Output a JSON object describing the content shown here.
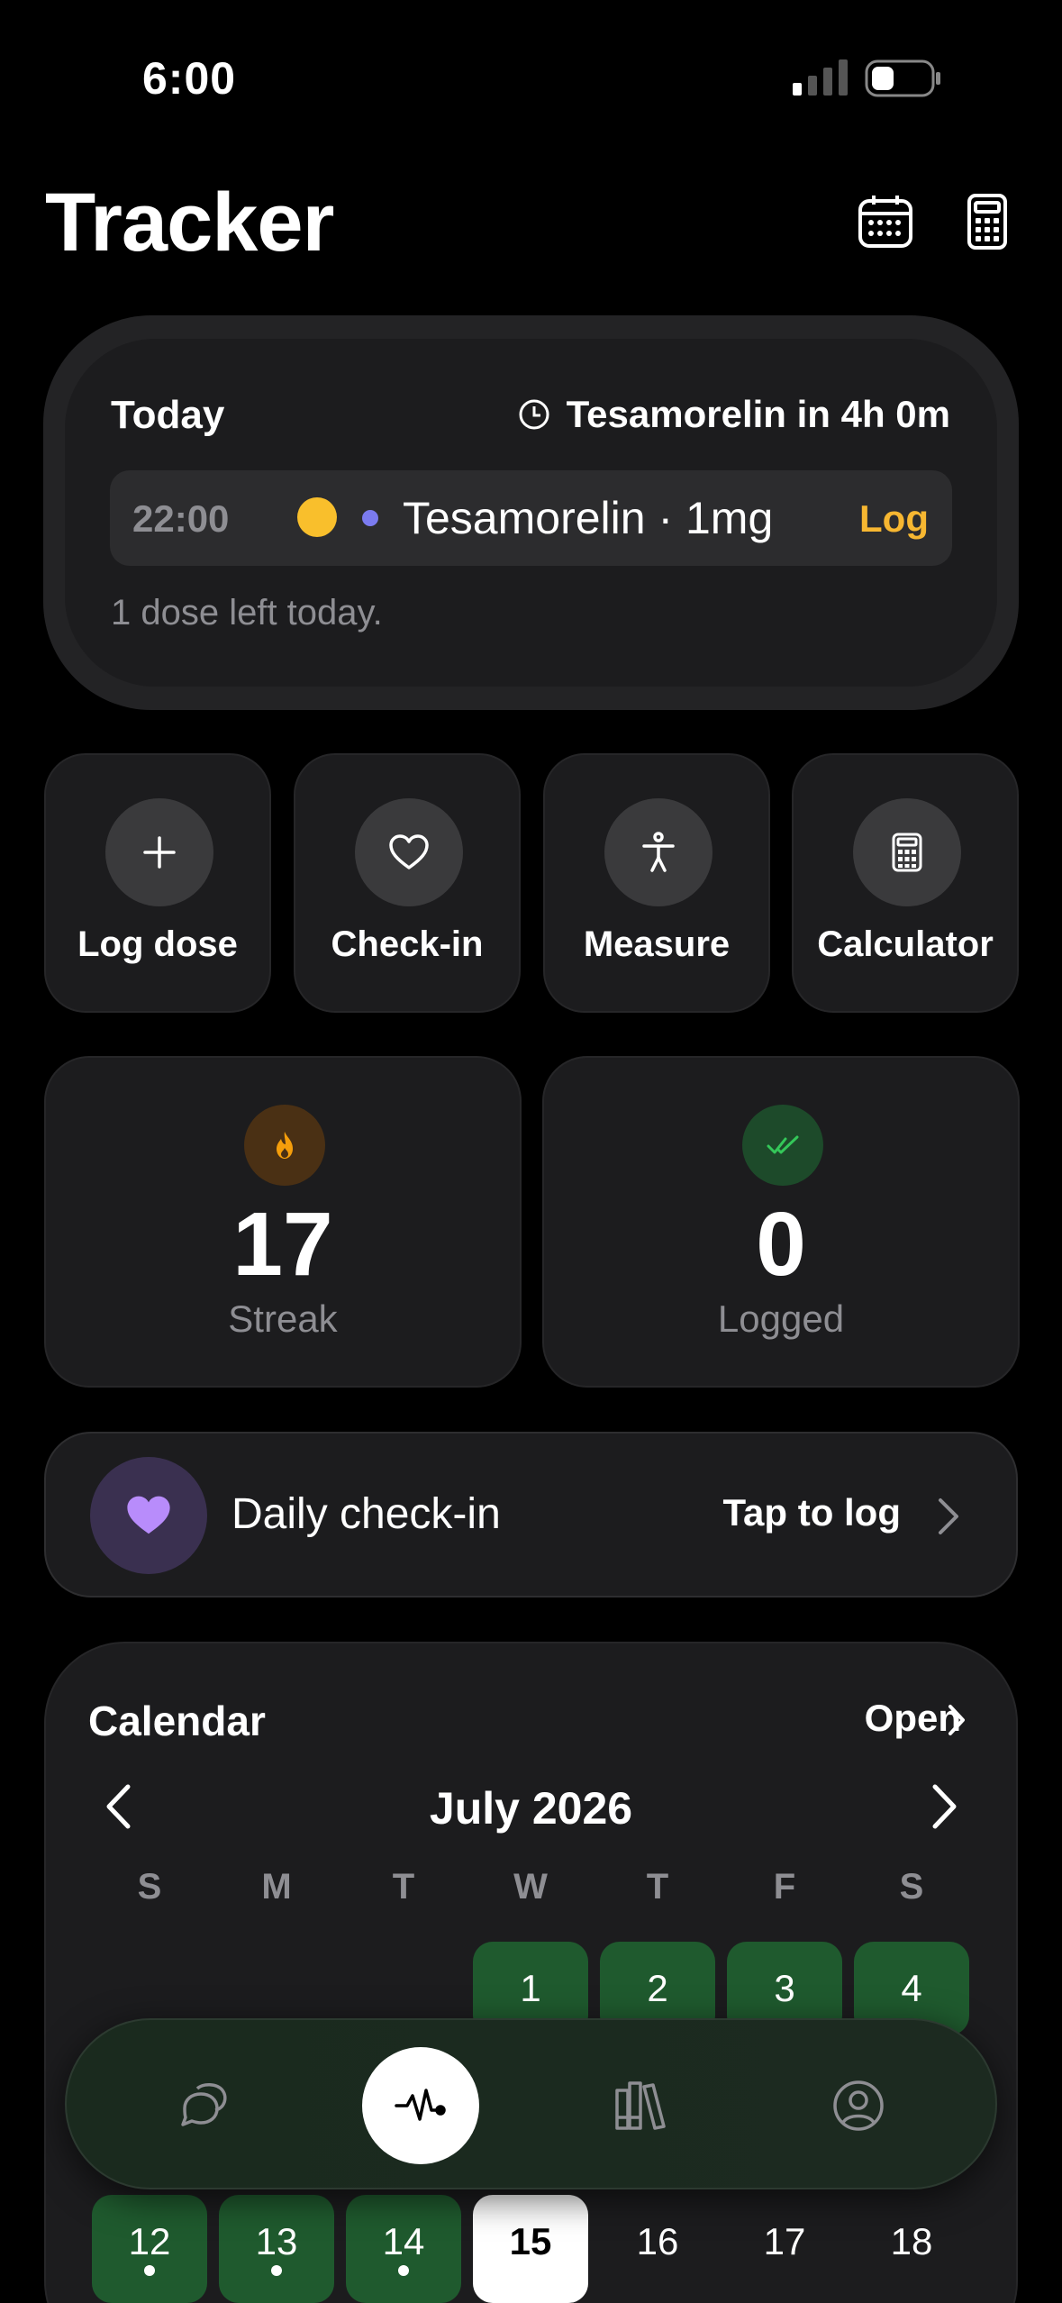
{
  "status_bar": {
    "time": "6:00"
  },
  "header": {
    "title": "Tracker",
    "icons": [
      "calendar-icon",
      "calculator-icon"
    ]
  },
  "today": {
    "label": "Today",
    "next_dose": "Tesamorelin in 4h 0m",
    "dose": {
      "time": "22:00",
      "name": "Tesamorelin · 1mg",
      "action": "Log"
    },
    "remaining": "1 dose left today."
  },
  "quick_actions": [
    {
      "label": "Log dose",
      "icon": "plus-icon"
    },
    {
      "label": "Check-in",
      "icon": "heart-icon"
    },
    {
      "label": "Measure",
      "icon": "person-icon"
    },
    {
      "label": "Calculator",
      "icon": "calculator-icon"
    }
  ],
  "stats": {
    "streak": {
      "value": "17",
      "label": "Streak",
      "icon": "flame-icon"
    },
    "logged": {
      "value": "0",
      "label": "Logged",
      "icon": "double-check-icon"
    }
  },
  "checkin": {
    "label": "Daily check-in",
    "cta": "Tap to log"
  },
  "calendar": {
    "title": "Calendar",
    "open": "Open",
    "month": "July 2026",
    "weekdays": [
      "S",
      "M",
      "T",
      "W",
      "T",
      "F",
      "S"
    ],
    "row1": [
      "1",
      "2",
      "3",
      "4"
    ],
    "row3": [
      "12",
      "13",
      "14",
      "15",
      "16",
      "17",
      "18"
    ]
  },
  "tabs": [
    "chat-icon",
    "activity-icon",
    "library-icon",
    "profile-icon"
  ],
  "colors": {
    "accent": "#f7b731",
    "logged_green": "#1f5a2e",
    "purple": "#a78bfa"
  }
}
